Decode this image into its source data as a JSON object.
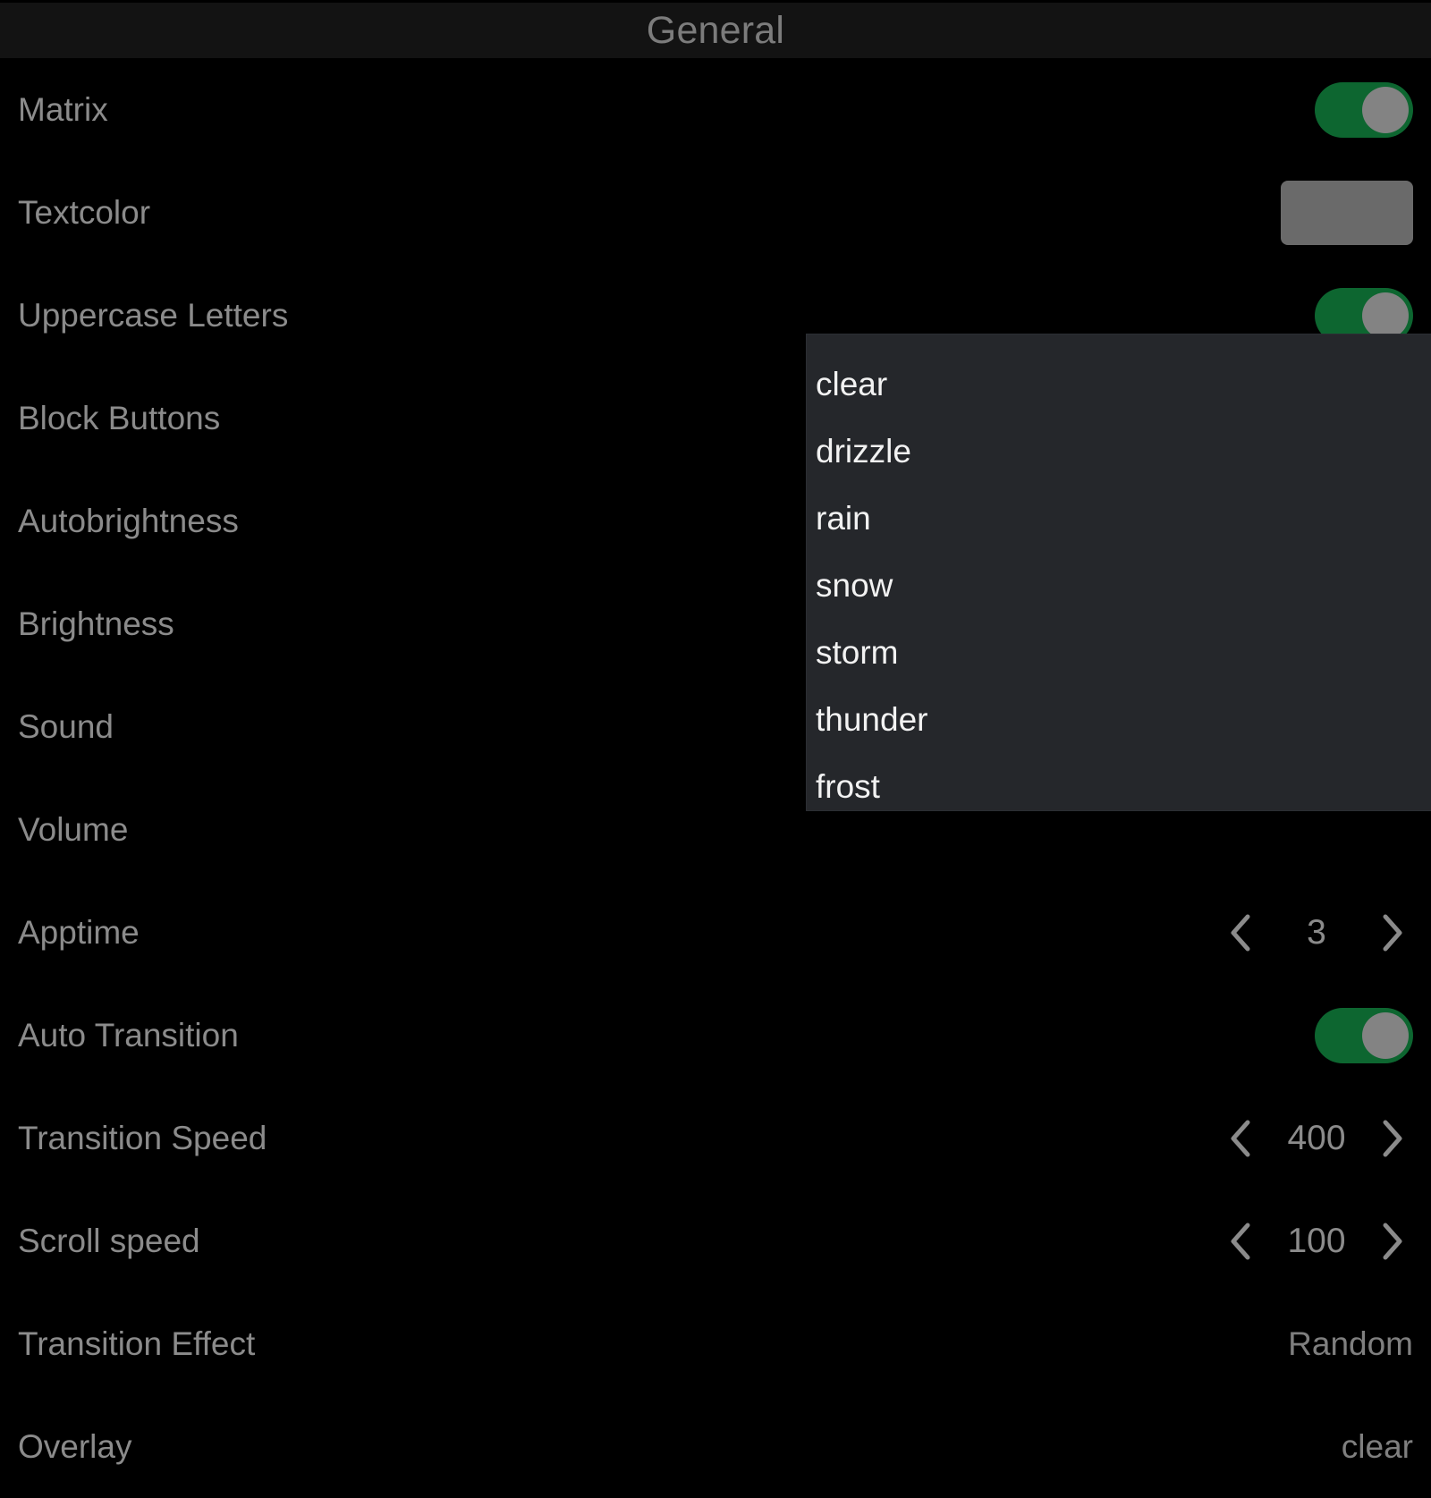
{
  "header": {
    "title": "General"
  },
  "colors": {
    "background": "#000000",
    "header_background": "#131313",
    "label": "#8b8b8b",
    "toggle_on_track": "#0d6630",
    "toggle_knob": "#838383",
    "textcolor_swatch": "#6a6a6a",
    "dropdown_background": "#25272b",
    "dropdown_text": "#f2f2f2"
  },
  "settings": [
    {
      "label": "Matrix",
      "control": "toggle",
      "value": "on"
    },
    {
      "label": "Textcolor",
      "control": "swatch",
      "value": "#6a6a6a"
    },
    {
      "label": "Uppercase Letters",
      "control": "toggle",
      "value": "on"
    },
    {
      "label": "Block Buttons",
      "control": "none",
      "value": ""
    },
    {
      "label": "Autobrightness",
      "control": "none",
      "value": ""
    },
    {
      "label": "Brightness",
      "control": "none",
      "value": ""
    },
    {
      "label": "Sound",
      "control": "none",
      "value": ""
    },
    {
      "label": "Volume",
      "control": "none",
      "value": ""
    },
    {
      "label": "Apptime",
      "control": "stepper",
      "value": "3"
    },
    {
      "label": "Auto Transition",
      "control": "toggle",
      "value": "on"
    },
    {
      "label": "Transition Speed",
      "control": "stepper",
      "value": "400"
    },
    {
      "label": "Scroll speed",
      "control": "stepper",
      "value": "100"
    },
    {
      "label": "Transition Effect",
      "control": "text",
      "value": "Random"
    },
    {
      "label": "Overlay",
      "control": "text",
      "value": "clear"
    }
  ],
  "dropdown": {
    "open": true,
    "options": [
      "clear",
      "drizzle",
      "rain",
      "snow",
      "storm",
      "thunder",
      "frost"
    ]
  },
  "icons": {
    "prev": "chevron-left-icon",
    "next": "chevron-right-icon"
  }
}
